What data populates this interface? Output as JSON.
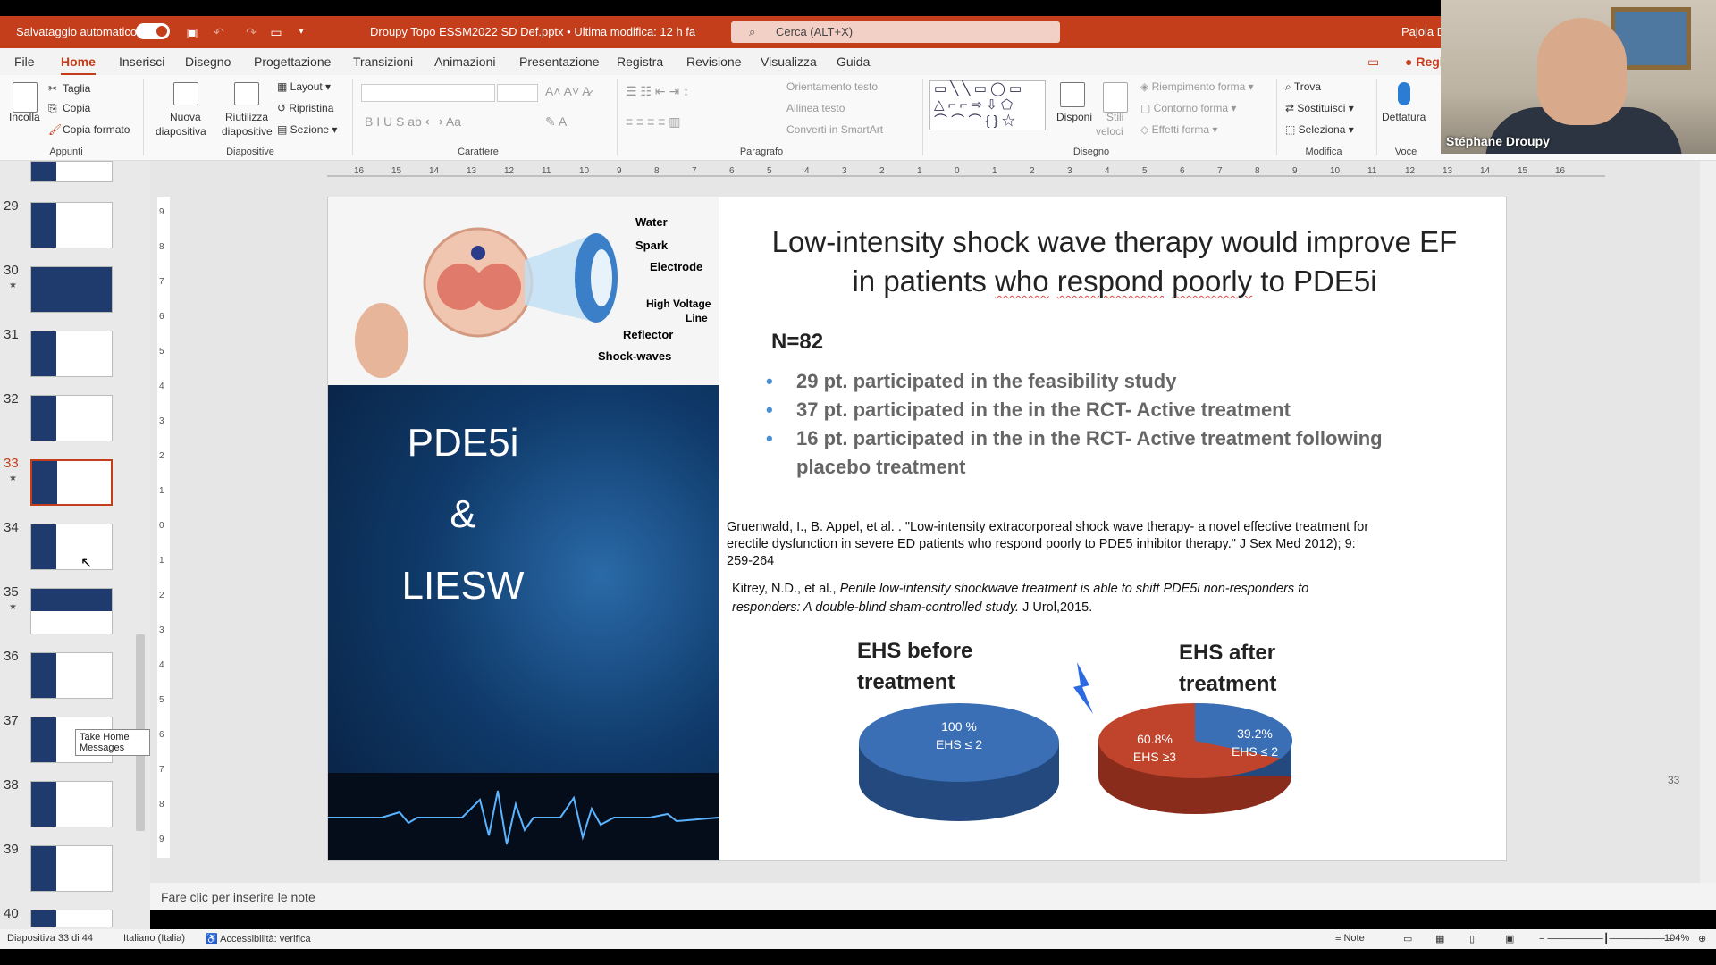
{
  "titlebar": {
    "autosave_label": "Salvataggio automatico",
    "document_title": "Droupy Topo ESSM2022 SD Def.pptx • Ultima modifica: 12 h fa",
    "search_placeholder": "Cerca (ALT+X)",
    "user_name": "Pajola D"
  },
  "tabs": [
    "File",
    "Home",
    "Inserisci",
    "Disegno",
    "Progettazione",
    "Transizioni",
    "Animazioni",
    "Presentazione",
    "Registra",
    "Revisione",
    "Visualizza",
    "Guida"
  ],
  "ribbon": {
    "clipboard": {
      "paste": "Incolla",
      "cut": "Taglia",
      "copy": "Copia",
      "format_painter": "Copia formato",
      "group": "Appunti"
    },
    "slides": {
      "new_slide_1": "Nuova",
      "new_slide_2": "diapositiva",
      "reuse_1": "Riutilizza",
      "reuse_2": "diapositive",
      "layout": "Layout",
      "reset": "Ripristina",
      "section": "Sezione",
      "group": "Diapositive"
    },
    "font": {
      "group": "Carattere"
    },
    "paragraph": {
      "text_direction": "Orientamento testo",
      "align_text": "Allinea testo",
      "smartart": "Converti in SmartArt",
      "group": "Paragrafo"
    },
    "drawing": {
      "arrange": "Disponi",
      "quick_styles_1": "Stili",
      "quick_styles_2": "veloci",
      "fill": "Riempimento forma",
      "outline": "Contorno forma",
      "effects": "Effetti forma",
      "group": "Disegno"
    },
    "editing": {
      "find": "Trova",
      "replace": "Sostituisci",
      "select": "Seleziona",
      "group": "Modifica"
    },
    "voice": {
      "dictate": "Dettatura",
      "group": "Voce"
    },
    "record": "Regi"
  },
  "thumbnails": {
    "numbers": [
      "29",
      "30",
      "31",
      "32",
      "33",
      "34",
      "35",
      "36",
      "37",
      "38",
      "39",
      "40"
    ],
    "tooltip": "Take Home Messages"
  },
  "slide": {
    "title_line1_a": "Low-intensity shock wave therapy would improve EF",
    "title_line2_a": "in patients ",
    "title_w1": "who",
    "title_w2": "respond",
    "title_w3": "poorly",
    "title_line2_b": " to PDE5i",
    "image_labels": {
      "water": "Water",
      "spark": "Spark",
      "electrode": "Electrode",
      "hv1": "High Voltage",
      "hv2": "Line",
      "reflector": "Reflector",
      "shock": "Shock-waves"
    },
    "left_words": [
      "PDE5i",
      "&",
      "LIESW"
    ],
    "n": "N=82",
    "bullets": [
      "29 pt. participated in the feasibility study",
      "37 pt. participated in the in the RCT- Active treatment",
      "16 pt. participated in the in the RCT- Active treatment following  placebo treatment"
    ],
    "ref1": "Gruenwald, I., B. Appel, et al. . \"Low-intensity extracorporeal shock wave therapy- a novel effective treatment for erectile  dysfunction in severe ED patients who respond poorly to PDE5 inhibitor therapy.\" J Sex Med 2012); 9:  259-264",
    "ref2_a": "Kitrey, N.D., et al., ",
    "ref2_italic": "Penile low-intensity shockwave treatment is able to shift PDE5i non-responders to responders: A double-blind sham-controlled study.",
    "ref2_b": " J Urol,2015.",
    "pie_before_title_1": "EHS before",
    "pie_before_title_2": "treatment",
    "pie_after_title_1": "EHS after",
    "pie_after_title_2": "treatment",
    "pie_before_pct": "100 %",
    "pie_before_cat": "EHS ≤ 2",
    "pie_after_red_pct": "60.8%",
    "pie_after_red_cat": "EHS ≥3",
    "pie_after_blue_pct": "39.2%",
    "pie_after_blue_cat": "EHS ≤ 2",
    "page_number": "33"
  },
  "pie_values": {
    "before_blue": 100,
    "after_red": 60.8,
    "after_blue": 39.2
  },
  "colors": {
    "accent": "#c43e1c",
    "pie_blue": "#3a6fb5",
    "pie_red": "#c0432b"
  },
  "notes_placeholder": "Fare clic per inserire le note",
  "status": {
    "slide_count": "Diapositiva 33 di 44",
    "language": "Italiano (Italia)",
    "accessibility": "Accessibilità: verifica",
    "notes": "Note",
    "zoom": "104%"
  },
  "webcam": {
    "name": "Stéphane Droupy"
  }
}
